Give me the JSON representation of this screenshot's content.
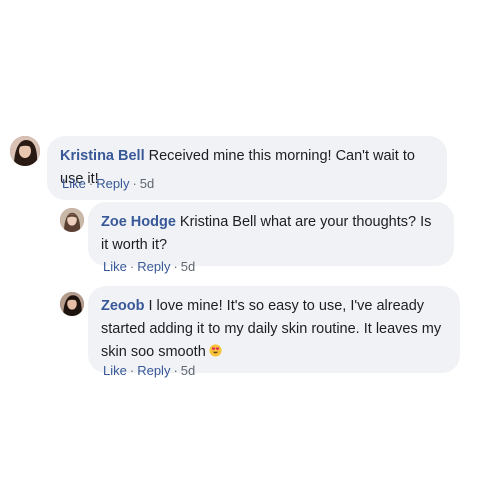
{
  "comments": [
    {
      "author": "Kristina Bell",
      "text": "Received mine this morning! Can't wait to use it!",
      "like": "Like",
      "reply": "Reply",
      "time": "5d"
    },
    {
      "author": "Zoe Hodge",
      "text": "Kristina Bell what are your thoughts? Is it worth it?",
      "like": "Like",
      "reply": "Reply",
      "time": "5d"
    },
    {
      "author": "Zeoob",
      "text": "I love mine! It's so easy to use, I've already started adding it to my daily skin routine. It leaves my skin soo smooth",
      "emoji": "heart-eyes-emoji",
      "like": "Like",
      "reply": "Reply",
      "time": "5d"
    }
  ]
}
